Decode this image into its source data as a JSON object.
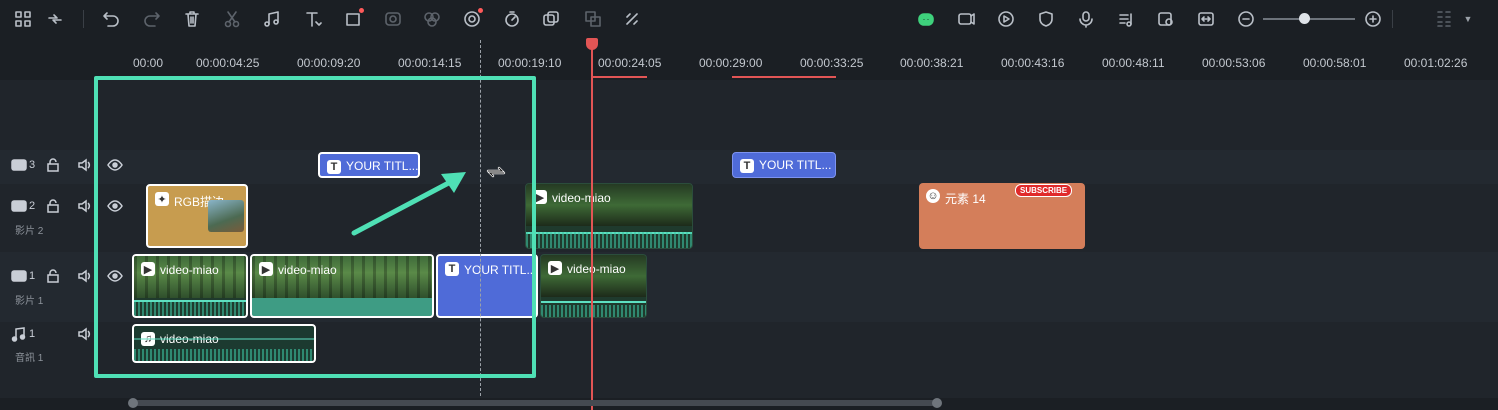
{
  "ruler": {
    "ticks": [
      "00:00",
      "00:00:04:25",
      "00:00:09:20",
      "00:00:14:15",
      "00:00:19:10",
      "00:00:24:05",
      "00:00:29:00",
      "00:00:33:25",
      "00:00:38:21",
      "00:00:43:16",
      "00:00:48:11",
      "00:00:53:06",
      "00:00:58:01",
      "00:01:02:26"
    ]
  },
  "tracks": {
    "overlay3": {
      "number": "3"
    },
    "video2": {
      "number": "2",
      "name": "影片 2"
    },
    "video1": {
      "number": "1",
      "name": "影片 1"
    },
    "audio1": {
      "number": "1",
      "name": "音訊 1"
    }
  },
  "clips": {
    "title_a": {
      "label": "YOUR TITL..."
    },
    "title_b": {
      "label": "YOUR TITL..."
    },
    "rgb": {
      "label": "RGB描边"
    },
    "video_track2": {
      "label": "video-miao"
    },
    "element": {
      "label": "元素 14"
    },
    "subscribe": {
      "label": "SUBSCRIBE"
    },
    "v1_a": {
      "label": "video-miao"
    },
    "v1_b": {
      "label": "video-miao"
    },
    "v1_title": {
      "label": "YOUR TITL..."
    },
    "v1_c": {
      "label": "video-miao"
    },
    "audio": {
      "label": "video-miao"
    }
  },
  "icons": [
    "grid-icon",
    "link-icon",
    "undo-icon",
    "redo-icon",
    "delete-icon",
    "cut-icon",
    "audio-icon",
    "text-icon",
    "crop-icon",
    "mask-icon",
    "color-icon",
    "ai-icon",
    "speed-icon",
    "stabilize-icon",
    "translate-icon",
    "detach-icon",
    "robot-icon",
    "render-icon",
    "play-icon",
    "shield-icon",
    "mic-icon",
    "music-icon",
    "camera-icon",
    "fit-icon",
    "zoom-out-icon",
    "zoom-in-icon",
    "layout-icon"
  ],
  "colors": {
    "accent": "#4fe0b5",
    "playhead": "#e25555",
    "title_clip": "#4f6bd8",
    "element_clip": "#d47e5a",
    "rgb_clip": "#c79c4f"
  }
}
